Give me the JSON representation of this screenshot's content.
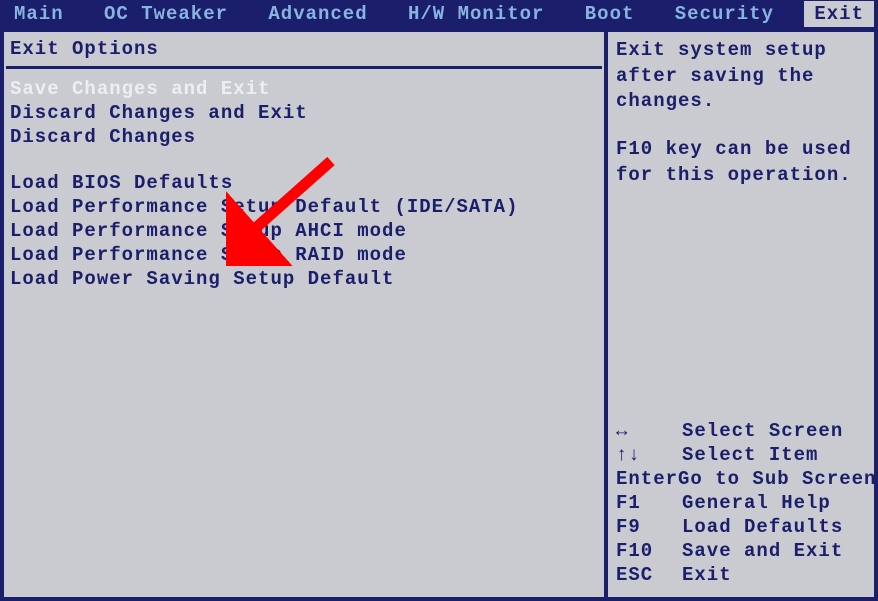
{
  "menubar": {
    "tabs": [
      {
        "label": "Main"
      },
      {
        "label": "OC Tweaker"
      },
      {
        "label": "Advanced"
      },
      {
        "label": "H/W Monitor"
      },
      {
        "label": "Boot"
      },
      {
        "label": "Security"
      },
      {
        "label": "Exit",
        "active": true
      }
    ]
  },
  "left_panel": {
    "title": "Exit Options",
    "selected_index": 0,
    "group1": [
      "Save Changes and Exit",
      "Discard Changes and Exit",
      "Discard Changes"
    ],
    "group2": [
      "Load BIOS Defaults",
      "Load Performance Setup Default (IDE/SATA)",
      "Load Performance Setup AHCI mode",
      "Load Performance Setup RAID mode",
      "Load Power Saving Setup Default"
    ]
  },
  "right_panel": {
    "help1": "Exit system setup after saving the changes.",
    "help2": "F10 key can be used for this operation.",
    "keyhints": [
      {
        "key": "↔",
        "desc": "Select Screen"
      },
      {
        "key": "↑↓",
        "desc": "Select Item"
      },
      {
        "key": "Enter",
        "desc": "Go to Sub Screen"
      },
      {
        "key": "F1",
        "desc": "General Help"
      },
      {
        "key": "F9",
        "desc": "Load Defaults"
      },
      {
        "key": "F10",
        "desc": "Save and Exit"
      },
      {
        "key": "ESC",
        "desc": "Exit"
      }
    ]
  },
  "annotation": {
    "arrow_color": "#ff0000",
    "target": "Load BIOS Defaults"
  }
}
